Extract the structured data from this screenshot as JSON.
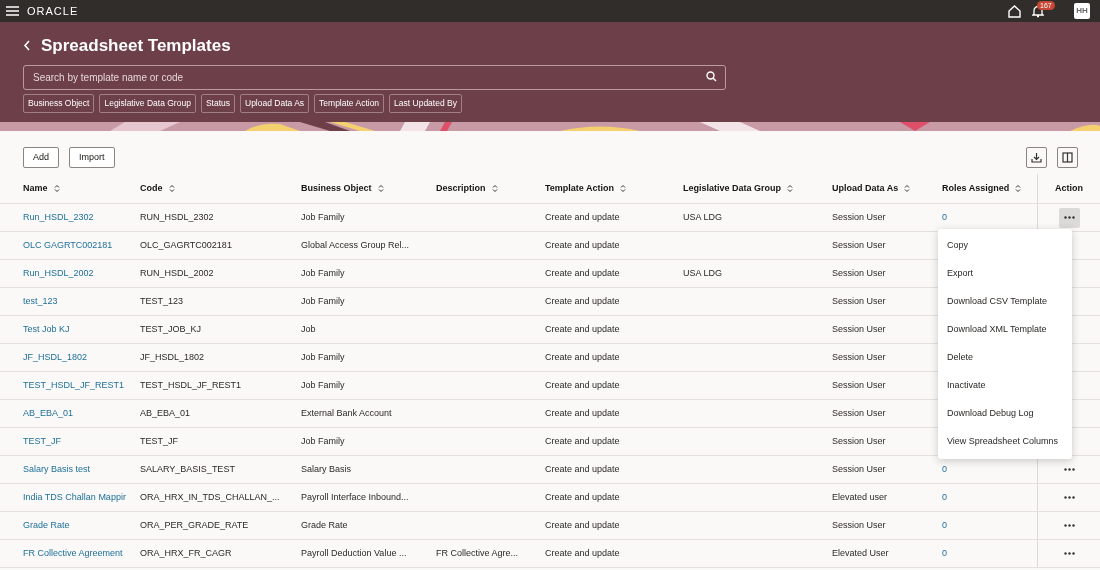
{
  "top_bar": {
    "brand": "ORACLE",
    "notification_count": "167",
    "avatar_initials": "HH"
  },
  "page": {
    "title": "Spreadsheet Templates",
    "search": {
      "placeholder": "Search by template name or code"
    },
    "filters": [
      "Business Object",
      "Legislative Data Group",
      "Status",
      "Upload Data As",
      "Template Action",
      "Last Updated By"
    ]
  },
  "toolbar": {
    "buttons": [
      "Add",
      "Import"
    ]
  },
  "table": {
    "columns": [
      {
        "label": "Name",
        "sortable": true
      },
      {
        "label": "Code",
        "sortable": true
      },
      {
        "label": "Business Object",
        "sortable": true
      },
      {
        "label": "Description",
        "sortable": true
      },
      {
        "label": "Template Action",
        "sortable": true
      },
      {
        "label": "Legislative Data Group",
        "sortable": true
      },
      {
        "label": "Upload Data As",
        "sortable": true
      },
      {
        "label": "Roles Assigned",
        "sortable": true
      },
      {
        "label": "Action",
        "sortable": false
      }
    ],
    "rows": [
      {
        "name": "Run_HSDL_2302",
        "code": "RUN_HSDL_2302",
        "business_object": "Job Family",
        "template_action": "Create and update",
        "legislative_data_group": "USA LDG",
        "upload_data_as": "Session User",
        "roles_assigned": "0",
        "action_selected": true
      },
      {
        "name": "OLC GAGRTC002181",
        "code": "OLC_GAGRTC002181",
        "business_object": "Global Access Group Rel...",
        "template_action": "Create and update",
        "upload_data_as": "Session User"
      },
      {
        "name": "Run_HSDL_2002",
        "code": "RUN_HSDL_2002",
        "business_object": "Job Family",
        "template_action": "Create and update",
        "legislative_data_group": "USA LDG",
        "upload_data_as": "Session User"
      },
      {
        "name": "test_123",
        "code": "TEST_123",
        "business_object": "Job Family",
        "template_action": "Create and update",
        "upload_data_as": "Session User"
      },
      {
        "name": "Test Job KJ",
        "code": "TEST_JOB_KJ",
        "business_object": "Job",
        "template_action": "Create and update",
        "upload_data_as": "Session User"
      },
      {
        "name": "JF_HSDL_1802",
        "code": "JF_HSDL_1802",
        "business_object": "Job Family",
        "template_action": "Create and update",
        "upload_data_as": "Session User"
      },
      {
        "name": "TEST_HSDL_JF_REST1",
        "code": "TEST_HSDL_JF_REST1",
        "business_object": "Job Family",
        "template_action": "Create and update",
        "upload_data_as": "Session User"
      },
      {
        "name": "AB_EBA_01",
        "code": "AB_EBA_01",
        "business_object": "External Bank Account",
        "template_action": "Create and update",
        "upload_data_as": "Session User"
      },
      {
        "name": "TEST_JF",
        "code": "TEST_JF",
        "business_object": "Job Family",
        "template_action": "Create and update",
        "upload_data_as": "Session User"
      },
      {
        "name": "Salary Basis test",
        "code": "SALARY_BASIS_TEST",
        "business_object": "Salary Basis",
        "template_action": "Create and update",
        "upload_data_as": "Session User",
        "roles_assigned": "0",
        "action_selected": false
      },
      {
        "name": "India TDS Challan Mappir",
        "code": "ORA_HRX_IN_TDS_CHALLAN_...",
        "business_object": "Payroll Interface Inbound...",
        "template_action": "Create and update",
        "upload_data_as": "Elevated user",
        "roles_assigned": "0",
        "action_selected": false
      },
      {
        "name": "Grade Rate",
        "code": "ORA_PER_GRADE_RATE",
        "business_object": "Grade Rate",
        "template_action": "Create and update",
        "upload_data_as": "Session User",
        "roles_assigned": "0",
        "action_selected": false
      },
      {
        "name": "FR Collective Agreement",
        "code": "ORA_HRX_FR_CAGR",
        "business_object": "Payroll Deduction Value ...",
        "description": "FR Collective Agre...",
        "template_action": "Create and update",
        "upload_data_as": "Elevated User",
        "roles_assigned": "0",
        "action_selected": false
      }
    ]
  },
  "action_menu": {
    "items": [
      "Copy",
      "Export",
      "Download CSV Template",
      "Download XML Template",
      "Delete",
      "Inactivate",
      "Download Debug Log",
      "View Spreadsheet Columns"
    ]
  }
}
